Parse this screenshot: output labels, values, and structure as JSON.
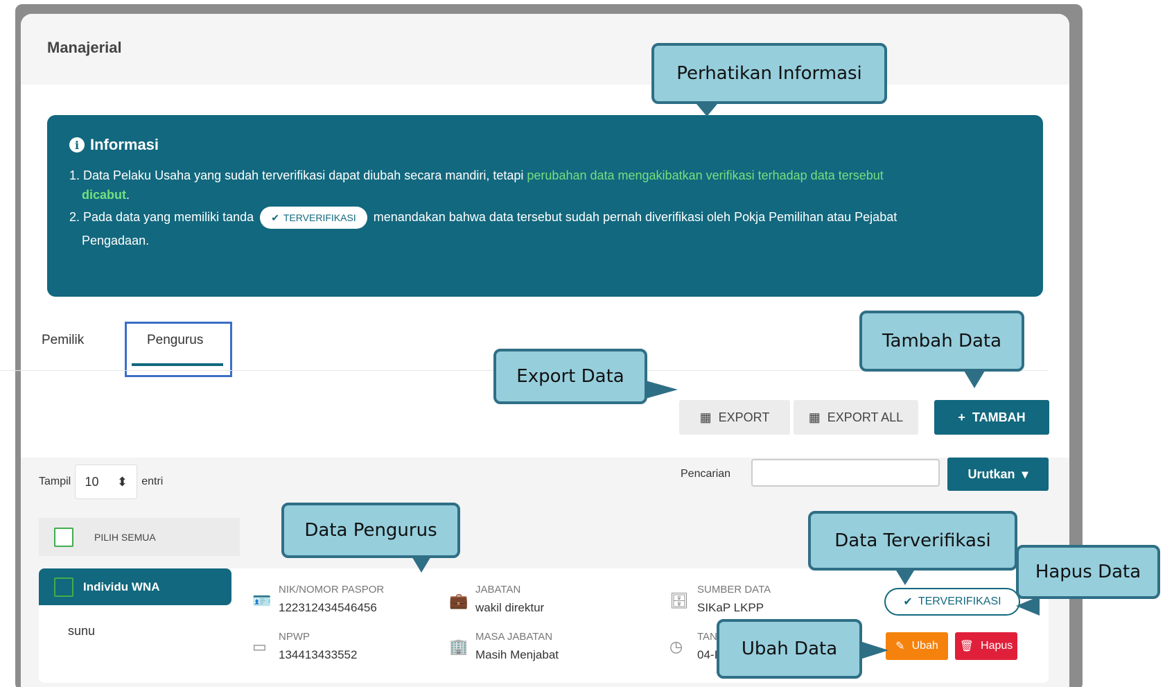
{
  "card": {
    "title": "Manajerial"
  },
  "info": {
    "heading": "Informasi",
    "line1_prefix": "1. Data Pelaku Usaha yang sudah terverifikasi dapat diubah secara mandiri, tetapi",
    "line1_highlight": "perubahan data mengakibatkan verifikasi terhadap data tersebut",
    "line1_highlight2": "dicabut",
    "line1_end": ".",
    "line2_prefix": "2. Pada data yang memiliki tanda",
    "line2_badge": "TERVERIFIKASI",
    "line2_suffix": "menandakan bahwa data tersebut sudah pernah diverifikasi oleh Pokja Pemilihan atau Pejabat",
    "line3": "Pengadaan."
  },
  "tabs": {
    "pemilik": "Pemilik",
    "pengurus": "Pengurus"
  },
  "toolbar": {
    "export": "EXPORT",
    "export_all": "EXPORT ALL",
    "tambah": "TAMBAH"
  },
  "table": {
    "tampil": "Tampil",
    "page_size": "10",
    "entri": "entri",
    "search_label": "Pencarian",
    "search_value": "",
    "sort_button": "Urutkan",
    "select_all": "PILIH SEMUA"
  },
  "row": {
    "category": "Individu WNA",
    "name": "sunu",
    "nik_label": "NIK/NOMOR PASPOR",
    "nik_value": "122312434546456",
    "npwp_label": "NPWP",
    "npwp_value": "134413433552",
    "jabatan_label": "JABATAN",
    "jabatan_value": "wakil direktur",
    "masa_label": "MASA JABATAN",
    "masa_value": "Masih Menjabat",
    "sumber_label": "SUMBER DATA",
    "sumber_value": "SIKaP LKPP",
    "tanggal_label": "TAN",
    "tanggal_value": "04-I",
    "status": "TERVERIFIKASI",
    "ubah": "Ubah",
    "hapus": "Hapus"
  },
  "callouts": {
    "perhatikan": "Perhatikan Informasi",
    "tambah": "Tambah Data",
    "export": "Export Data",
    "pengurus": "Data Pengurus",
    "terverifikasi": "Data Terverifikasi",
    "hapus": "Hapus Data",
    "ubah": "Ubah Data"
  },
  "colors": {
    "primary": "#12687e",
    "callout_fill": "#96cedc",
    "callout_border": "#2f6f86",
    "highlight": "#73e07f",
    "ubah": "#f5820d",
    "hapus": "#e0203a"
  }
}
